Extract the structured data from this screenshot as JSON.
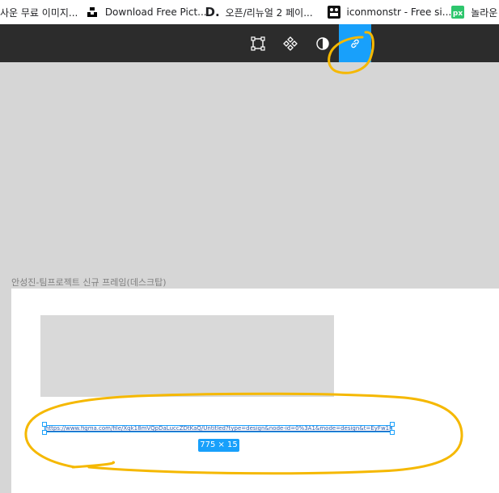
{
  "bookmarks": [
    {
      "label": "사운 무료 이미지...",
      "icon": "page-icon"
    },
    {
      "label": "Download Free Pict...",
      "icon": "unsplash-icon"
    },
    {
      "label": "오픈/리뉴얼 2 페이...",
      "icon": "d-logo-icon"
    },
    {
      "label": "iconmonstr - Free si...",
      "icon": "iconmonstr-icon"
    },
    {
      "label": "놀라운",
      "icon": "px-icon"
    }
  ],
  "toolbar": {
    "tools": [
      {
        "name": "frame-tool",
        "icon": "frame-select-icon"
      },
      {
        "name": "component-tool",
        "icon": "component-icon"
      },
      {
        "name": "mask-tool",
        "icon": "contrast-icon"
      },
      {
        "name": "link-tool",
        "icon": "link-icon",
        "active": true
      }
    ],
    "active_color": "#18a0fb"
  },
  "canvas": {
    "frame_label": "안성진-팀프로젝트 신규 프레임(데스크탑)",
    "link_text": "https://www.figma.com/file/Xqk18mVQpDaLuccZDtKaQ/Untitled?type=design&node-id=0%3A1&mode=design&t=EyFw1KnL9OmhF8c8-0",
    "selection_size": "775 × 15"
  },
  "colors": {
    "selection": "#18a0fb",
    "annotation": "#f5b800",
    "toolbar_bg": "#2c2c2c"
  }
}
